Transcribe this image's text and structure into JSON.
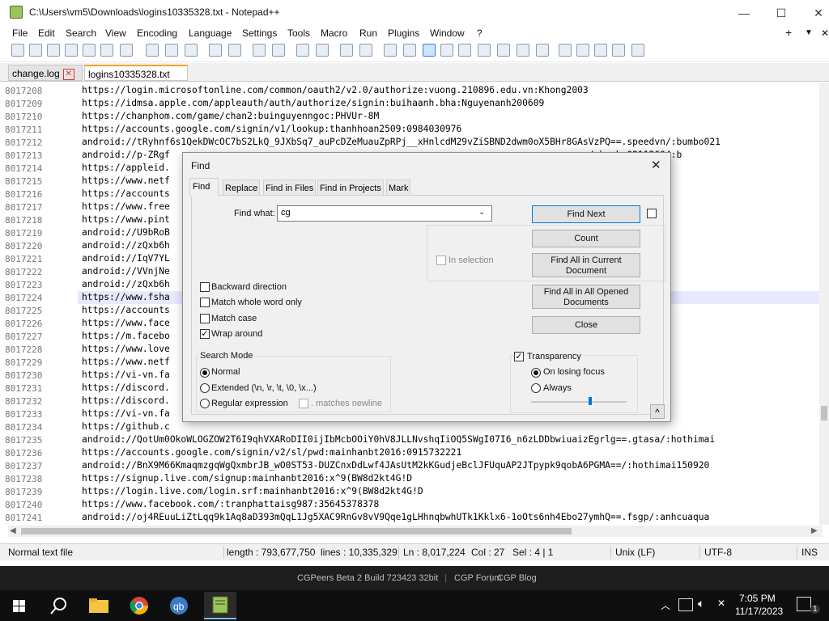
{
  "window": {
    "title": "C:\\Users\\vm5\\Downloads\\logins10335328.txt - Notepad++",
    "minimize": "—",
    "maximize": "☐",
    "close": "✕"
  },
  "menu": {
    "items": [
      "File",
      "Edit",
      "Search",
      "View",
      "Encoding",
      "Language",
      "Settings",
      "Tools",
      "Macro",
      "Run",
      "Plugins",
      "Window",
      "?"
    ],
    "plus": "+",
    "dropdown": "▼",
    "close": "✕"
  },
  "tabs": [
    {
      "label": "change.log"
    },
    {
      "label": "logins10335328.txt"
    }
  ],
  "editor": {
    "lines": [
      {
        "num": "8017208",
        "text": "https://login.microsoftonline.com/common/oauth2/v2.0/authorize:vuong.210896.edu.vn:Khong2003"
      },
      {
        "num": "8017209",
        "text": "https://idmsa.apple.com/appleauth/auth/authorize/signin:buihaanh.bha:Nguyenanh200609"
      },
      {
        "num": "8017210",
        "text": "https://chanphom.com/game/chan2:buinguyenngoc:PHVUr-8M"
      },
      {
        "num": "8017211",
        "text": "https://accounts.google.com/signin/v1/lookup:thanhhoan2509:0984030976"
      },
      {
        "num": "8017212",
        "text": "android://tRyhnf6s1QekDWcOC7bS2LkQ_9JXbSq7_auPcDZeMuauZpRPj__xHnlcdM29vZiSBND2dwm0oX5BHr8GAsVzPQ==.speedvn/:bumbo021"
      },
      {
        "num": "8017213",
        "text": "android://p-ZRgf                                                                     xgmsg==/:bumbo02112004:b"
      },
      {
        "num": "8017214",
        "text": "https://appleid."
      },
      {
        "num": "8017215",
        "text": "https://www.netf"
      },
      {
        "num": "8017216",
        "text": "https://accounts"
      },
      {
        "num": "8017217",
        "text": "https://www.free"
      },
      {
        "num": "8017218",
        "text": "https://www.pint"
      },
      {
        "num": "8017219",
        "text": "android://U9bRoB                                                               ygaiKQ==.android/:buivan"
      },
      {
        "num": "8017220",
        "text": "android://zQxb6h                                                               PB9FA==.orca/:sauluytre"
      },
      {
        "num": "8017221",
        "text": "android://IqV7YL                                                               Popug==.trans/:dcktl5:1"
      },
      {
        "num": "8017222",
        "text": "android://VVnjNe                                                               X3ykaQ==.smartcity/:dck"
      },
      {
        "num": "8017223",
        "text": "android://zQxb6h                                                               PB9FA==.katana/:sauluytr"
      },
      {
        "num": "8017224",
        "text": "https://www.fsha"
      },
      {
        "num": "8017225",
        "text": "https://accounts"
      },
      {
        "num": "8017226",
        "text": "https://www.face"
      },
      {
        "num": "8017227",
        "text": "https://m.facebo"
      },
      {
        "num": "8017228",
        "text": "https://www.love"
      },
      {
        "num": "8017229",
        "text": "https://www.netf"
      },
      {
        "num": "8017230",
        "text": "https://vi-vn.fa"
      },
      {
        "num": "8017231",
        "text": "https://discord."
      },
      {
        "num": "8017232",
        "text": "https://discord."
      },
      {
        "num": "8017233",
        "text": "https://vi-vn.fa"
      },
      {
        "num": "8017234",
        "text": "https://github.c"
      },
      {
        "num": "8017235",
        "text": "android://QotUm0OkoWLOGZOW2T6I9qhVXARoDII0ijIbMcbOOiY0hV8JLLNvshqIiOQ5SWgI07I6_n6zLDDbwiuaizEgrlg==.gtasa/:hothimai"
      },
      {
        "num": "8017236",
        "text": "https://accounts.google.com/signin/v2/sl/pwd:mainhanbt2016:0915732221"
      },
      {
        "num": "8017237",
        "text": "android://BnX9M66KmaqmzgqWgQxmbrJB_wO0ST53-DUZCnxDdLwf4JAsUtM2kKGudjeBclJFUquAP2JTpypk9qobA6PGMA==/:hothimai150920"
      },
      {
        "num": "8017238",
        "text": "https://signup.live.com/signup:mainhanbt2016:x^9(BW8d2kt4G!D"
      },
      {
        "num": "8017239",
        "text": "https://login.live.com/login.srf:mainhanbt2016:x^9(BW8d2kt4G!D"
      },
      {
        "num": "8017240",
        "text": "https://www.facebook.com/:tranphattaisg987:35645378378"
      },
      {
        "num": "8017241",
        "text": "android://oj4REuuLiZtLqq9k1Aq8aD393mQqL1Jg5XAC9RnGv8vV9Qqe1gLHhnqbwhUTk1Kklx6-1oOts6nh4Ebo27ymhQ==.fsgp/:anhcuaqua"
      }
    ]
  },
  "status": {
    "type": "Normal text file",
    "length": "length : 793,677,750",
    "lines": "lines : 10,335,329",
    "pos": "Ln : 8,017,224",
    "col": "Col : 27",
    "sel": "Sel : 4 | 1",
    "eol": "Unix (LF)",
    "encoding": "UTF-8",
    "mode": "INS"
  },
  "cgbar": {
    "build": "CGPeers Beta 2 Build 723423 32bit",
    "forum": "CGP Forum",
    "blog": "CGP Blog"
  },
  "taskbar": {
    "time": "7:05 PM",
    "date": "11/17/2023",
    "notif_count": "1"
  },
  "find": {
    "title": "Find",
    "close": "✕",
    "tabs": [
      "Find",
      "Replace",
      "Find in Files",
      "Find in Projects",
      "Mark"
    ],
    "find_what_label": "Find what:",
    "find_what_value": "cg",
    "in_selection": "In selection",
    "backward": "Backward direction",
    "whole_word": "Match whole word only",
    "match_case": "Match case",
    "wrap_around": "Wrap around",
    "search_mode": "Search Mode",
    "mode_normal": "Normal",
    "mode_extended": "Extended (\\n, \\r, \\t, \\0, \\x...)",
    "mode_regex": "Regular expression",
    "matches_newline": ". matches newline",
    "btn_find_next": "Find Next",
    "btn_count": "Count",
    "btn_find_all_current_1": "Find All in Current",
    "btn_find_all_current_2": "Document",
    "btn_find_all_opened_1": "Find All in All Opened",
    "btn_find_all_opened_2": "Documents",
    "btn_close": "Close",
    "transparency": "Transparency",
    "on_losing_focus": "On losing focus",
    "always": "Always",
    "transparency_level": 0.6,
    "collapse": "^"
  }
}
